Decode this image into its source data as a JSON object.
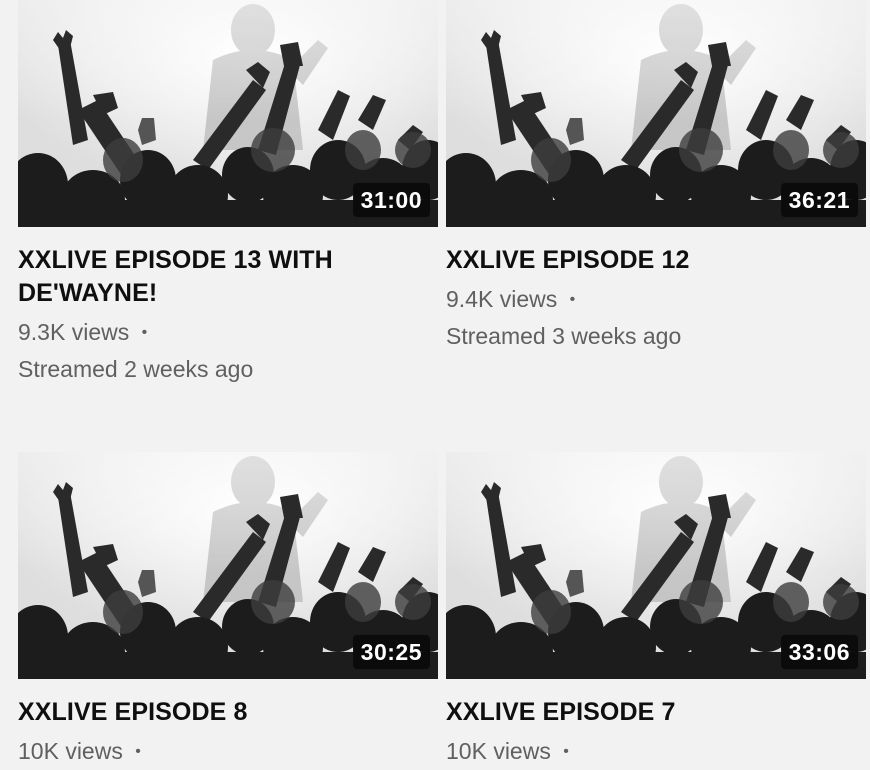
{
  "videos": [
    {
      "title": "XXLIVE EPISODE 13 WITH DE'WAYNE!",
      "duration": "31:00",
      "views": "9.3K views",
      "separator": "•",
      "streamed": "Streamed 2 weeks ago",
      "thumbnail_icon": "concert-crowd-thumbnail"
    },
    {
      "title": "XXLIVE EPISODE 12",
      "duration": "36:21",
      "views": "9.4K views",
      "separator": "•",
      "streamed": "Streamed 3 weeks ago",
      "thumbnail_icon": "concert-crowd-thumbnail"
    },
    {
      "title": "XXLIVE EPISODE 8",
      "duration": "30:25",
      "views": "10K views",
      "separator": "•",
      "streamed": "",
      "thumbnail_icon": "concert-crowd-thumbnail"
    },
    {
      "title": "XXLIVE EPISODE 7",
      "duration": "33:06",
      "views": "10K views",
      "separator": "•",
      "streamed": "",
      "thumbnail_icon": "concert-crowd-thumbnail"
    }
  ]
}
